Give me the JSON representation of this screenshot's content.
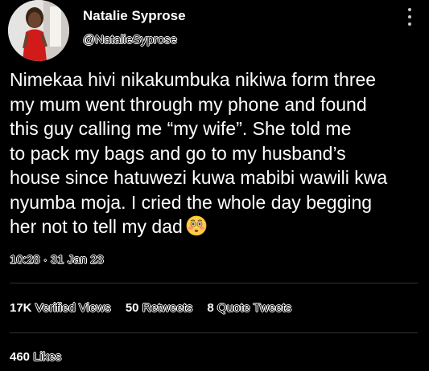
{
  "author": {
    "name": "Natalie Syprose",
    "handle": "@NatalieSyprose"
  },
  "tweet": {
    "lines": [
      "Nimekaa hivi nikakumbuka nikiwa form three",
      "my mum went through my phone and found",
      "this guy calling me “my wife”. She told me",
      "to pack my bags and go to my husband’s",
      "house since hatuwezi kuwa mabibi wawili kwa",
      "nyumba moja. I cried the whole day begging",
      "her not to tell my dad"
    ],
    "emoji": "flushed-face-emoji",
    "time": "10:28",
    "separator": "·",
    "date": "31 Jan 23"
  },
  "stats": {
    "views_count": "17K",
    "views_label": "Verified Views",
    "retweets_count": "50",
    "retweets_label": "Retweets",
    "quotes_count": "8",
    "quotes_label": "Quote Tweets",
    "likes_count": "460",
    "likes_label": "Likes"
  },
  "colors": {
    "background": "#000000",
    "text": "#ffffff",
    "divider": "#2f3336",
    "avatar_dress": "#d11a1a"
  },
  "icons": {
    "more": "more-vertical-icon"
  }
}
